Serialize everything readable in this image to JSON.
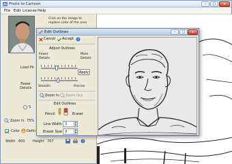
{
  "main_window": {
    "title": "Photo to Cartoon",
    "controls": {
      "minimize": "–",
      "maximize": "□",
      "close": "x"
    }
  },
  "menu": [
    "File",
    "Edit",
    "License",
    "Help"
  ],
  "hint": "Click on the image to replace color of the area",
  "left_panel": {
    "load_label": "Load Ph",
    "fewer_details": "Fewer\nDetails",
    "zoom_in": "Zoom In",
    "zoom_value": "75%",
    "color_label": "Color",
    "defin_label": "Defin",
    "width_label": "Width",
    "width_value": "600",
    "height_label": "Height",
    "height_value": "707"
  },
  "dialog": {
    "title": "Edit Outlines",
    "cancel": "Cancel",
    "accept": "Accept",
    "adjust_outlines": "Adjust Outlines",
    "fewer_details": "Fewer\nDetails",
    "more_details": "More\nDetails",
    "apply": "Apply",
    "smooth": "Smooth",
    "precise": "Precise",
    "zoom_in": "Zoom In",
    "zoom_out": "Zoom Out",
    "edit_outlines": "Edit Outlines",
    "pencil": "Pencil",
    "eraser": "Eraser",
    "line_width_label": "Line Width",
    "line_width_value": "3",
    "eraser_size_label": "Eraser Size",
    "eraser_size_value": "9",
    "controls": {
      "minimize": "–",
      "maximize": "□",
      "close": "x"
    }
  },
  "colors": {
    "accent": "#3a6fc4",
    "close": "#c7412a"
  }
}
